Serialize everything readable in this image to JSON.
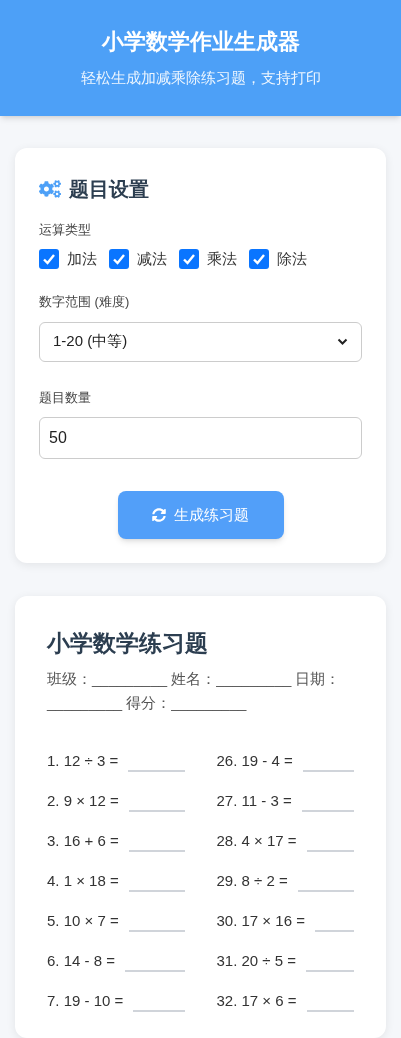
{
  "header": {
    "title": "小学数学作业生成器",
    "subtitle": "轻松生成加减乘除练习题，支持打印"
  },
  "settings": {
    "title": "题目设置",
    "operation_label": "运算类型",
    "operations": [
      {
        "label": "加法",
        "checked": true
      },
      {
        "label": "减法",
        "checked": true
      },
      {
        "label": "乘法",
        "checked": true
      },
      {
        "label": "除法",
        "checked": true
      }
    ],
    "range_label": "数字范围 (难度)",
    "range_value": "1-20 (中等)",
    "count_label": "题目数量",
    "count_value": "50",
    "generate_button": "生成练习题"
  },
  "worksheet": {
    "title": "小学数学练习题",
    "info": "班级：_________ 姓名：_________ 日期：_________ 得分：_________",
    "problems": [
      {
        "text": "1. 12 ÷ 3 ="
      },
      {
        "text": "26. 19 - 4 ="
      },
      {
        "text": "2. 9 × 12 ="
      },
      {
        "text": "27. 11 - 3 ="
      },
      {
        "text": "3. 16 + 6 ="
      },
      {
        "text": "28. 4 × 17 ="
      },
      {
        "text": "4. 1 × 18 ="
      },
      {
        "text": "29. 8 ÷ 2 ="
      },
      {
        "text": "5. 10 × 7 ="
      },
      {
        "text": "30. 17 × 16 ="
      },
      {
        "text": "6. 14 - 8 ="
      },
      {
        "text": "31. 20 ÷ 5 ="
      },
      {
        "text": "7. 19 - 10 ="
      },
      {
        "text": "32. 17 × 6 ="
      }
    ]
  }
}
